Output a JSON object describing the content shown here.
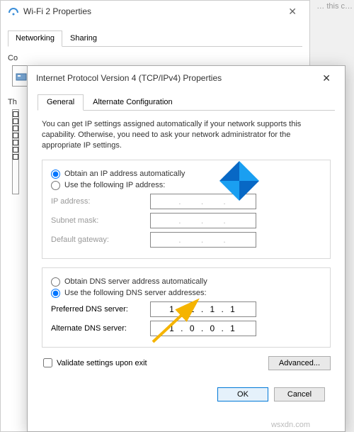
{
  "parent": {
    "title": "Wi-Fi 2 Properties",
    "tabs": {
      "networking": "Networking",
      "sharing": "Sharing"
    },
    "connect_label": "Connect using:",
    "section_label": "This connection uses the following items:"
  },
  "child": {
    "title": "Internet Protocol Version 4 (TCP/IPv4) Properties",
    "tabs": {
      "general": "General",
      "alternate": "Alternate Configuration"
    },
    "intro": "You can get IP settings assigned automatically if your network supports this capability. Otherwise, you need to ask your network administrator for the appropriate IP settings.",
    "ip_section": {
      "radio_auto": "Obtain an IP address automatically",
      "radio_manual": "Use the following IP address:",
      "ip_address_label": "IP address:",
      "subnet_label": "Subnet mask:",
      "gateway_label": "Default gateway:"
    },
    "dns_section": {
      "radio_auto": "Obtain DNS server address automatically",
      "radio_manual": "Use the following DNS server addresses:",
      "preferred_label": "Preferred DNS server:",
      "alternate_label": "Alternate DNS server:",
      "preferred_value": "1 . 1 . 1 . 1",
      "alternate_value": "1 . 0 . 0 . 1"
    },
    "validate_label": "Validate settings upon exit",
    "advanced_label": "Advanced...",
    "ok_label": "OK",
    "cancel_label": "Cancel"
  },
  "partial_bg_text": "… this c…",
  "watermark": "wsxdn.com"
}
